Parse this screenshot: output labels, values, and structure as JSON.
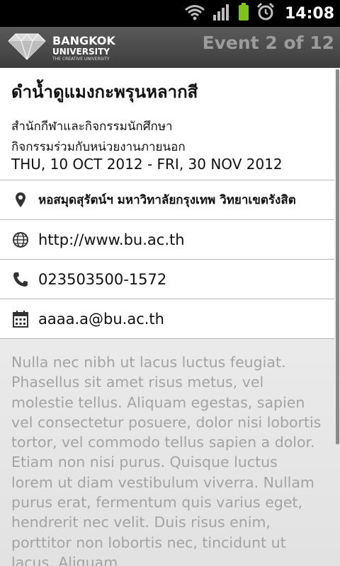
{
  "status_bar": {
    "time": "14:08",
    "icons": [
      "wifi-icon",
      "signal-icon",
      "battery-icon",
      "alarm-icon"
    ]
  },
  "action_bar": {
    "logo": {
      "line1": "BANGKOK",
      "line2": "UNIVERSITY",
      "line3": "THE CREATIVE UNIVERSITY"
    },
    "counter": "Event 2 of 12"
  },
  "event": {
    "title": "ดำน้ำดูแมงกะพรุนหลากสี",
    "organizer": "สำนักกีฬาและกิจกรรมนักศึกษา",
    "category": "กิจกรรมร่วมกับหน่วยงานภายนอก",
    "dates": "THU, 10 OCT 2012 - FRI, 30 NOV 2012",
    "location": "หอสมุดสุรัตน์ฯ มหาวิทาลัยกรุงเทพ วิทยาเขตรังสิต",
    "website": "http://www.bu.ac.th",
    "phone": "023503500-1572",
    "email": "aaaa.a@bu.ac.th",
    "description": "Nulla nec nibh ut lacus luctus feugiat. Phasellus sit amet risus metus, vel molestie tellus. Aliquam egestas, sapien vel consectetur posuere, dolor nisi lobortis tortor, vel commodo tellus sapien a dolor. Etiam non nisi purus. Quisque luctus lorem ut diam vestibulum viverra. Nullam purus erat, fermentum quis varius eget, hendrerit nec velit. Duis risus enim, porttitor non lobortis nec, tincidunt ut lacus. Aliquam"
  }
}
